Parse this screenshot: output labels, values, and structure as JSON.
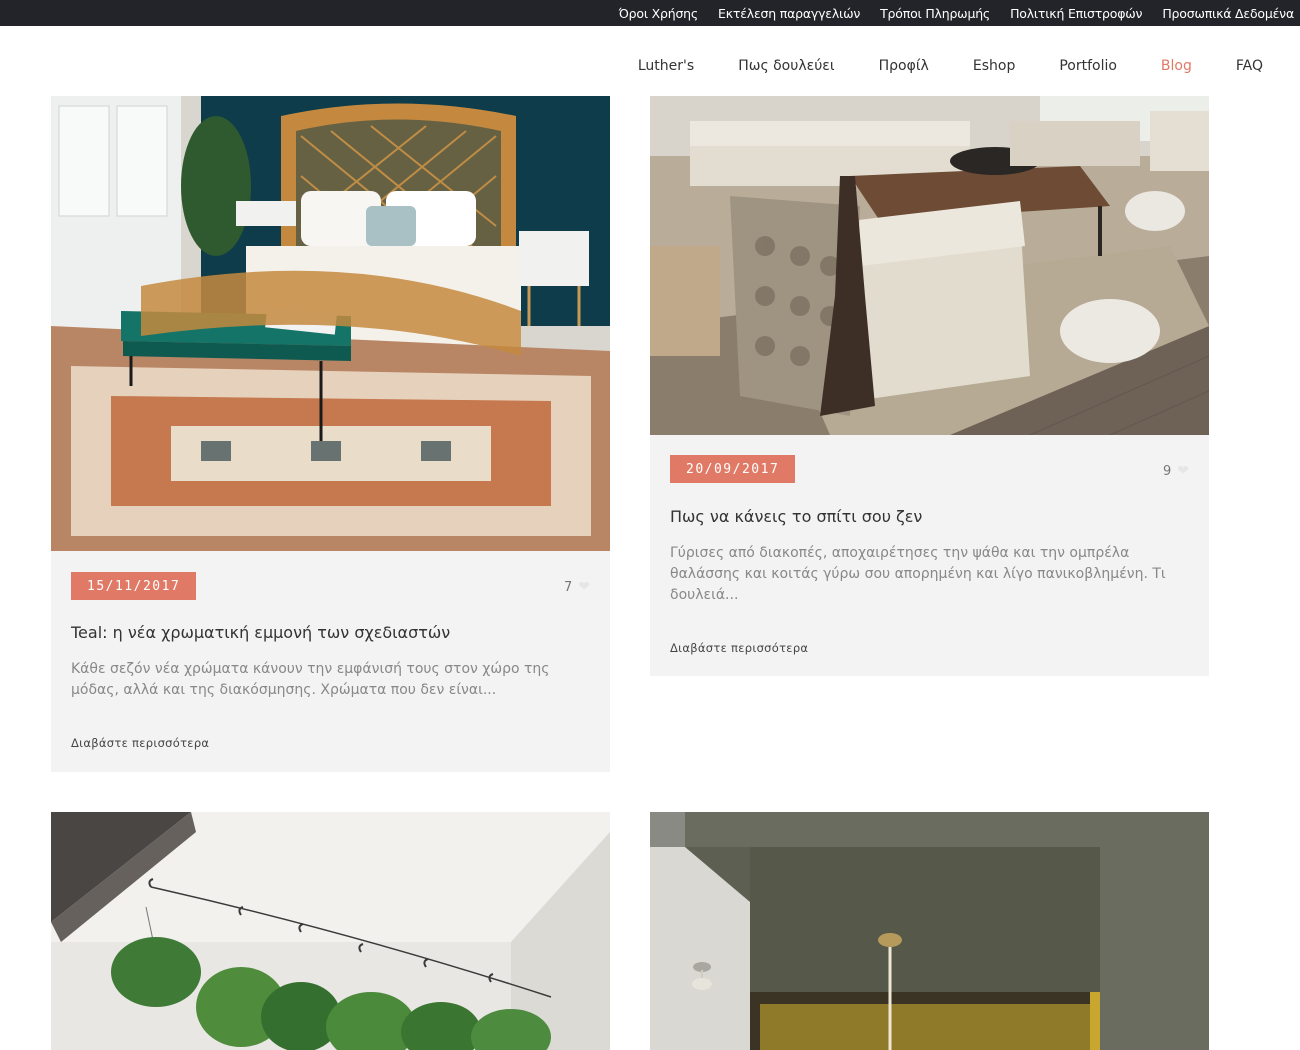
{
  "topbar": {
    "links": [
      "Όροι Χρήσης",
      "Εκτέλεση παραγγελιών",
      "Τρόποι Πληρωμής",
      "Πολιτική Επιστροφών",
      "Προσωπικά Δεδομένα"
    ]
  },
  "nav": {
    "items": [
      "Luther's",
      "Πως δουλεύει",
      "Προφίλ",
      "Eshop",
      "Portfolio",
      "Blog",
      "FAQ"
    ],
    "active": "Blog"
  },
  "posts": [
    {
      "date": "15/11/2017",
      "likes": "7",
      "title": "Teal: η νέα χρωματική εμμονή των σχεδιαστών",
      "excerpt": "Κάθε σεζόν νέα χρώματα κάνουν την εμφάνισή τους στον χώρο της μόδας, αλλά και της διακόσμησης. Χρώματα που δεν είναι...",
      "read_more": "Διαβάστε περισσότερα",
      "image": "bedroom-teal-wall-rattan-bed"
    },
    {
      "date": "20/09/2017",
      "likes": "9",
      "title": "Πως να κάνεις το σπίτι σου ζεν",
      "excerpt": "Γύρισες από διακοπές, αποχαιρέτησες την ψάθα και την ομπρέλα θαλάσσης και κοιτάς γύρω σου απορημένη και λίγο πανικοβλημένη. Τι δουλειά...",
      "read_more": "Διαβάστε περισσότερα",
      "image": "living-room-neutral-sofas"
    },
    {
      "image": "hanging-plants-wall"
    },
    {
      "image": "olive-ceiling-pendant-lamp"
    }
  ],
  "colors": {
    "accent": "#e07a66",
    "topbar_bg": "#222429",
    "card_bg": "#f3f3f3",
    "heart": "#e6e6e6"
  },
  "icons": {
    "like": "heart-icon"
  }
}
